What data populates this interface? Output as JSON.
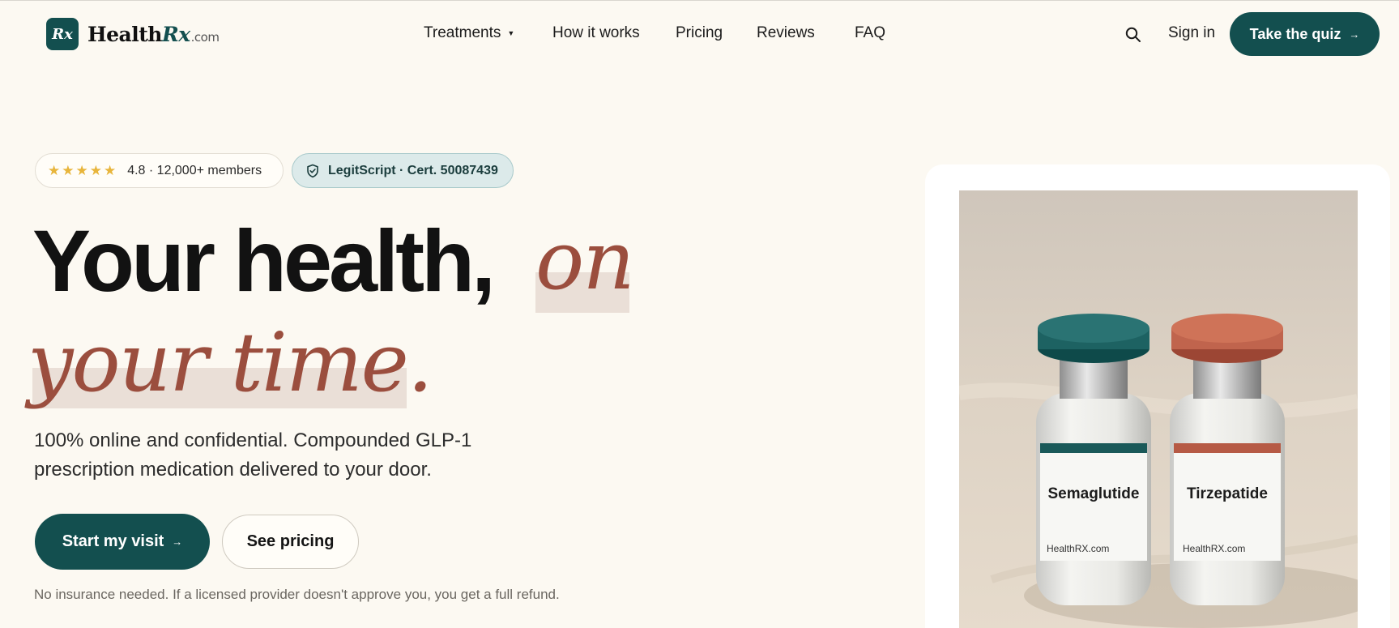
{
  "brand": {
    "badge": "Rx",
    "name_a": "Health",
    "name_b": "Rx",
    "domain": ".com"
  },
  "nav": {
    "items": [
      {
        "label": "Treatments",
        "has_caret": true
      },
      {
        "label": "How it works"
      },
      {
        "label": "Pricing"
      },
      {
        "label": "Reviews"
      },
      {
        "label": "FAQ"
      }
    ],
    "search_icon": "search-icon",
    "sign_in": "Sign in",
    "cta": "Take the quiz",
    "cta_arrow": "→"
  },
  "badges": {
    "stars": "★★★★★",
    "rating": "4.8 · 12,000+ members",
    "legit": "LegitScript · Cert. 50087439"
  },
  "hero": {
    "headline_main": "Your health,",
    "headline_accent_1": "on",
    "headline_accent_2": "your time.",
    "subtext": "100% online and confidential. Compounded GLP-1 prescription medication delivered to your door.",
    "primary_cta": "Start my visit",
    "primary_arrow": "→",
    "secondary_cta": "See pricing",
    "note": "No insurance needed. If a licensed provider doesn't approve you, you get a full refund."
  },
  "product_image": {
    "vial_1": {
      "label": "Semaglutide",
      "site": "HealthRX.com"
    },
    "vial_2": {
      "label": "Tirzepatide",
      "site": "HealthRX.com"
    }
  },
  "colors": {
    "brand_teal": "#134f4f",
    "accent_rust": "#9b4e3e",
    "background": "#fcf9f2",
    "star": "#e8b53b"
  }
}
